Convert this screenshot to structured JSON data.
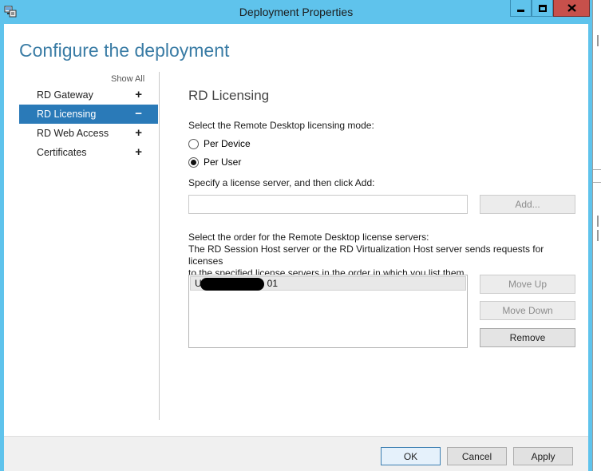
{
  "window": {
    "title": "Deployment Properties",
    "icon": "deployment-properties-icon",
    "controls": [
      "minimize-icon",
      "maximize-icon",
      "close-icon"
    ]
  },
  "header": {
    "title": "Configure the deployment"
  },
  "nav": {
    "show_all": "Show All",
    "items": [
      {
        "label": "RD Gateway",
        "sign": "+"
      },
      {
        "label": "RD Licensing",
        "sign": "−",
        "selected": true
      },
      {
        "label": "RD Web Access",
        "sign": "+"
      },
      {
        "label": "Certificates",
        "sign": "+"
      }
    ]
  },
  "licensing": {
    "section_title": "RD Licensing",
    "mode_label": "Select the Remote Desktop licensing mode:",
    "modes": [
      {
        "label": "Per Device",
        "selected": false
      },
      {
        "label": "Per User",
        "selected": true
      }
    ],
    "server_label": "Specify a license server, and then click Add:",
    "server_value": "",
    "add_button": "Add...",
    "order_label": "Select the order for the Remote Desktop license servers:",
    "order_desc_line1": "The RD Session Host server or the RD Virtualization Host server sends requests for licenses",
    "order_desc_line2": "to the specified license servers in the order in which you list them.",
    "servers": [
      {
        "prefix": "U",
        "suffix": "01"
      }
    ],
    "move_up_button": "Move Up",
    "move_down_button": "Move Down",
    "remove_button": "Remove"
  },
  "footer": {
    "ok": "OK",
    "cancel": "Cancel",
    "apply": "Apply"
  },
  "colors": {
    "titlebar": "#5fc3ec",
    "close_button": "#c7504b",
    "accent_title": "#3a7ca5",
    "selection": "#2a7ab8"
  }
}
